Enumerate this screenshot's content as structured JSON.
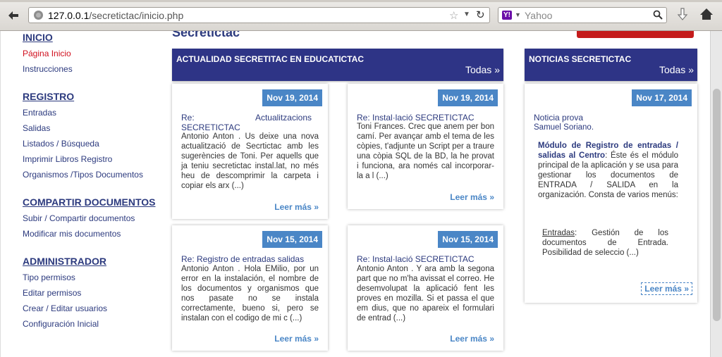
{
  "browser": {
    "url_host": "127.0.0.1",
    "url_path": "/secretictac/inicio.php",
    "search_engine": "Yahoo"
  },
  "page": {
    "top_title": "Secretictac",
    "sidebar": {
      "inicio": {
        "heading": "INICIO",
        "items": [
          "Página Inicio",
          "Instrucciones"
        ]
      },
      "registro": {
        "heading": "REGISTRO",
        "items": [
          "Entradas",
          "Salidas",
          "Listados / Búsqueda",
          "Imprimir Libros Registro",
          "Organismos /Tipos Documentos"
        ]
      },
      "compartir": {
        "heading": "COMPARTIR DOCUMENTOS",
        "items": [
          "Subir / Compartir documentos",
          "Modificar mis documentos"
        ]
      },
      "admin": {
        "heading": "ADMINISTRADOR",
        "items": [
          "Tipo permisos",
          "Editar permisos",
          "Crear / Editar usuarios",
          "Configuración Inicial"
        ]
      }
    },
    "actualidad": {
      "title": "ACTUALIDAD SECRETITAC EN EDUCATICTAC",
      "all_link": "Todas »",
      "posts": [
        {
          "date": "Nov 19, 2014",
          "title": "Re: Actualitzacions SECRETICTAC",
          "body": "Antonio Anton . Us deixe una nova actualització de Secrtictac amb les sugerències de Toni. Per aquells que ja teniu secretictac instal.lat, no més heu de descomprimir la carpeta i copiar els arx (...)",
          "more": "Leer más »"
        },
        {
          "date": "Nov 19, 2014",
          "title": "Re: Instal·lació SECRETICTAC",
          "body": "Toni Frances. Crec que anem per bon camí. Per avançar amb el tema de les còpies, t'adjunte un Script per a traure una còpia SQL de la BD, la he provat i funciona, ara només cal incorporar-la a l (...)",
          "more": "Leer más »"
        },
        {
          "date": "Nov 15, 2014",
          "title": "Re: Registro de entradas salidas",
          "body": "Antonio Anton . Hola EMilio, por un error en la instalación, el nombre de los documentos y organismos que nos pasate no se instala correctamente, bueno si, pero se instalan con el codigo de mi c (...)",
          "more": "Leer más »"
        },
        {
          "date": "Nov 15, 2014",
          "title": "Re: Instal·lació SECRETICTAC",
          "body": "Antonio Anton . Y ara amb la segona part que no m'ha avissat el correo. He desemvolupat la aplicació fent les proves en mozilla. Si et passa el que em dius, que no apareix el formulari de entrad (...)",
          "more": "Leer más »"
        }
      ]
    },
    "noticias": {
      "title": "NOTICIAS SECRETICTAC",
      "all_link": "Todas »",
      "post": {
        "date": "Nov 17, 2014",
        "title": "Noticia prova",
        "author": "Samuel Soriano.",
        "bold_intro": "Módulo de Registro de entradas / salidas al Centro",
        "intro_rest": ": Éste és el módulo principal de la aplicación y se usa para gestionar los documentos de ENTRADA / SALIDA en la organización. Consta de varios menús:",
        "entradas_link": "Entradas",
        "entradas_rest": ": Gestión de los documentos de Entrada. Posibilidad de seleccio (...)",
        "more": "Leer más »"
      }
    }
  },
  "colors": {
    "navy": "#2e3486",
    "link": "#2c3a7e",
    "active": "#d0101e",
    "badge": "#4a86c6"
  },
  "icons": [
    "back-arrow-icon",
    "globe-icon",
    "star-icon",
    "reload-icon",
    "yahoo-icon",
    "search-icon",
    "download-icon",
    "home-icon"
  ]
}
